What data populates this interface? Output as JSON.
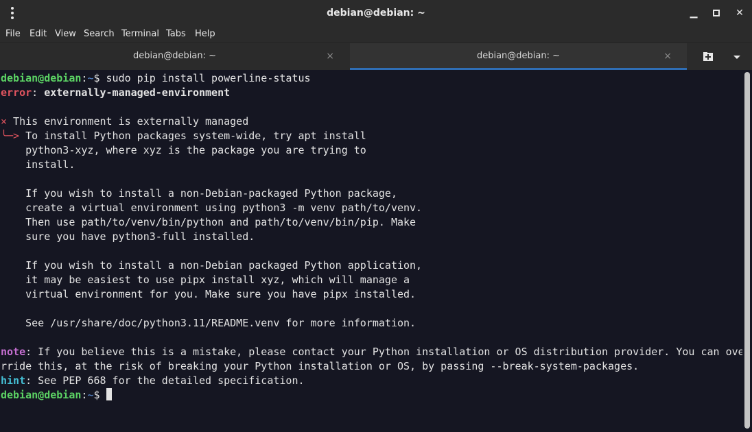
{
  "window": {
    "title": "debian@debian: ~",
    "minimize": "▁",
    "maximize": "■",
    "close": "✕"
  },
  "menu": [
    "File",
    "Edit",
    "View",
    "Search",
    "Terminal",
    "Tabs",
    "Help"
  ],
  "tabs": [
    {
      "label": "debian@debian: ~",
      "close": "×"
    },
    {
      "label": "debian@debian: ~",
      "close": "×"
    }
  ],
  "terminal": {
    "prompt_user": "debian@debian",
    "prompt_sep": ":",
    "prompt_dir": "~",
    "prompt_sym": "$ ",
    "command": "sudo pip install powerline-status",
    "error_label": "error",
    "error_sep": ": ",
    "error_text": "externally-managed-environment",
    "cross": "×",
    "managed_text": " This environment is externally managed",
    "arrow": "╰─>",
    "body": [
      " To install Python packages system-wide, try apt install",
      "    python3-xyz, where xyz is the package you are trying to",
      "    install.",
      "",
      "    If you wish to install a non-Debian-packaged Python package,",
      "    create a virtual environment using python3 -m venv path/to/venv.",
      "    Then use path/to/venv/bin/python and path/to/venv/bin/pip. Make",
      "    sure you have python3-full installed.",
      "",
      "    If you wish to install a non-Debian packaged Python application,",
      "    it may be easiest to use pipx install xyz, which will manage a",
      "    virtual environment for you. Make sure you have pipx installed.",
      "",
      "    See /usr/share/doc/python3.11/README.venv for more information."
    ],
    "note_label": "note",
    "note_text": ": If you believe this is a mistake, please contact your Python installation or OS distribution provider. You can ove",
    "note_text2": "rride this, at the risk of breaking your Python installation or OS, by passing --break-system-packages.",
    "hint_label": "hint",
    "hint_text": ": See PEP 668 for the detailed specification."
  }
}
